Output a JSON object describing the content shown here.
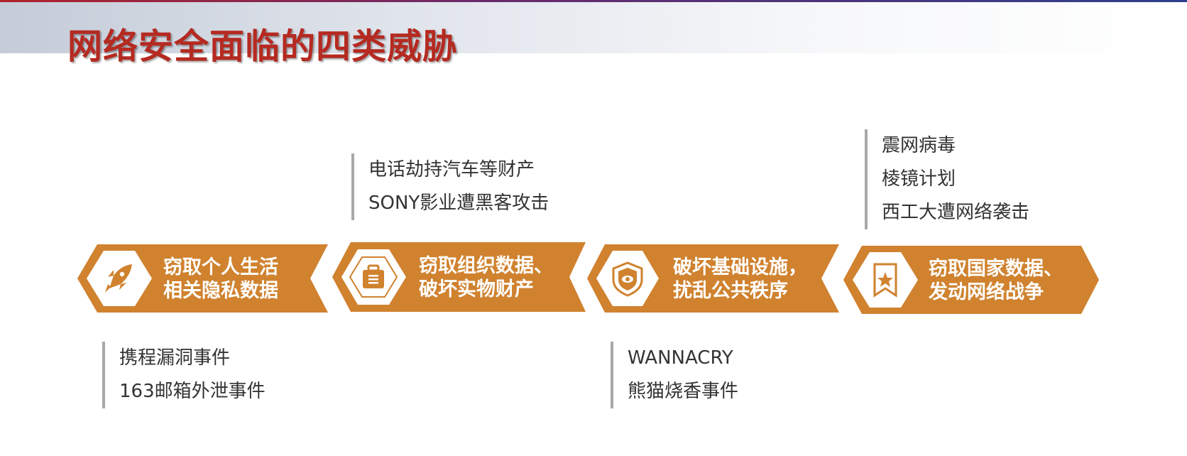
{
  "title": "网络安全面临的四类威胁",
  "colors": {
    "accent": "#d0822f",
    "title": "#b52a21",
    "text": "#333333",
    "note_bar": "#a8a8a8"
  },
  "steps": [
    {
      "icon": "rocket-icon",
      "line1": "窃取个人生活",
      "line2": "相关隐私数据"
    },
    {
      "icon": "briefcase-icon",
      "line1": "窃取组织数据、",
      "line2": "破坏实物财产"
    },
    {
      "icon": "shield-icon",
      "line1": "破坏基础设施，",
      "line2": "扰乱公共秩序"
    },
    {
      "icon": "star-badge-icon",
      "line1": "窃取国家数据、",
      "line2": "发动网络战争"
    }
  ],
  "notes": {
    "step1": [
      "携程漏洞事件",
      "163邮箱外泄事件"
    ],
    "step2": [
      "电话劫持汽车等财产",
      "SONY影业遭黑客攻击"
    ],
    "step3": [
      "WANNACRY",
      "熊猫烧香事件"
    ],
    "step4": [
      "震网病毒",
      "棱镜计划",
      "西工大遭网络袭击"
    ]
  }
}
